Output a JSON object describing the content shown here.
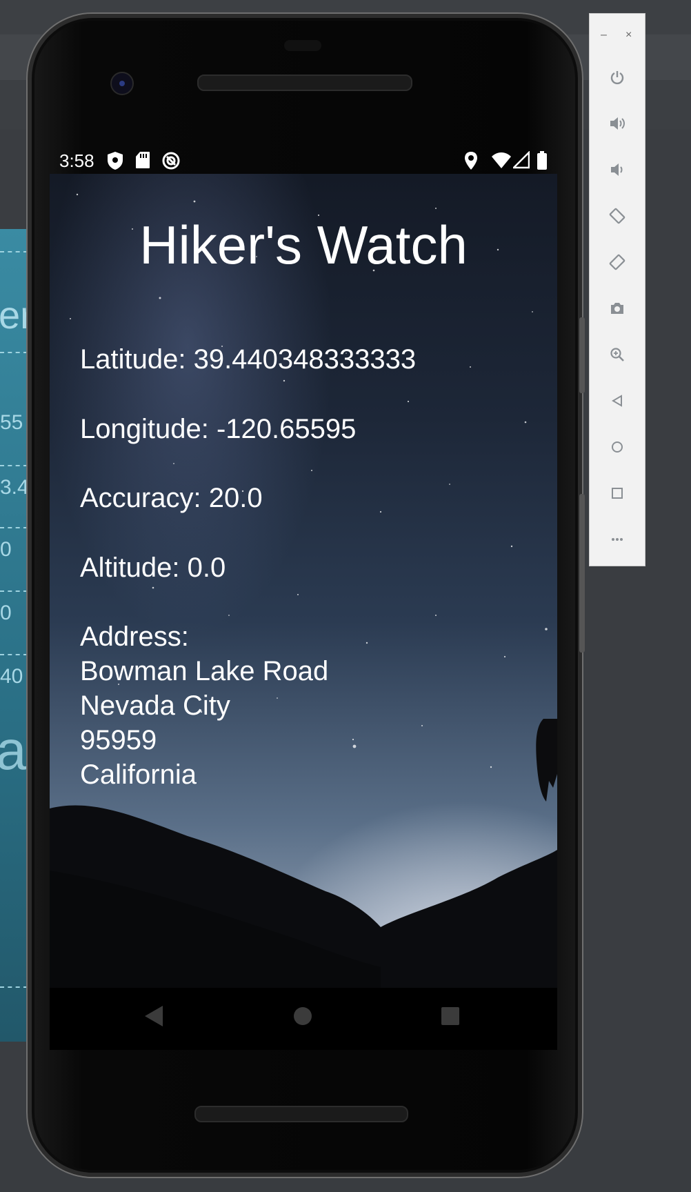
{
  "status_bar": {
    "time": "3:58",
    "left_icons": [
      "shield-icon",
      "sd-card-icon",
      "sync-icon"
    ],
    "right_icons": [
      "location-pin-icon",
      "wifi-icon",
      "cell-signal-icon",
      "battery-icon"
    ]
  },
  "app": {
    "title": "Hiker's Watch",
    "latitude": "Latitude: 39.440348333333",
    "longitude": "Longitude: -120.65595",
    "accuracy": "Accuracy: 20.0",
    "altitude": "Altitude: 0.0",
    "address_label": "Address:",
    "address_lines": [
      "Bowman Lake Road",
      "Nevada City",
      "95959",
      "California"
    ]
  },
  "nav_bar": [
    "back-icon",
    "home-icon",
    "recents-icon"
  ],
  "emulator_toolbar": {
    "window_controls": {
      "minimize": "–",
      "close": "×"
    },
    "buttons": [
      "power-icon",
      "volume-up-icon",
      "volume-down-icon",
      "rotate-left-icon",
      "rotate-right-icon",
      "camera-icon",
      "zoom-icon",
      "back-icon",
      "home-icon",
      "overview-icon",
      "more-icon"
    ]
  },
  "background_preview": {
    "fragments": [
      "er",
      "55",
      "3.4",
      "0",
      "0",
      "40 :",
      "a"
    ]
  },
  "colors": {
    "screen_text": "#ffffff",
    "toolbar_bg": "#f2f2f2",
    "toolbar_icon": "#8a8f94",
    "preview_bg": "#2a6f85"
  }
}
